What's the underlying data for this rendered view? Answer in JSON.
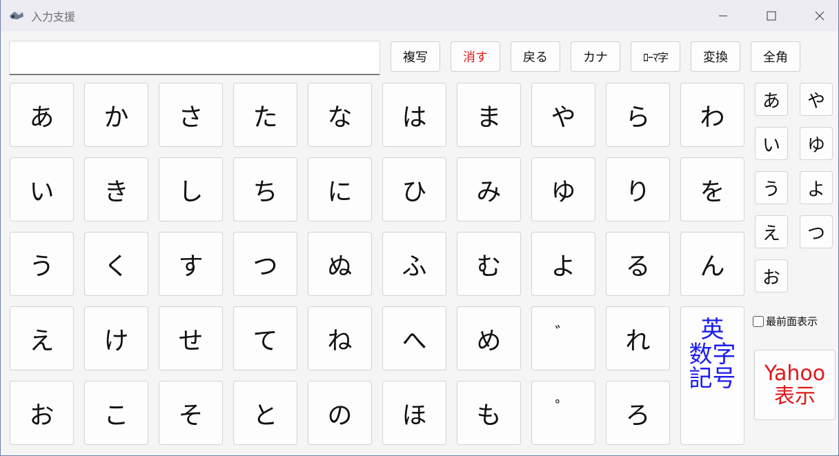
{
  "window": {
    "title": "入力支援"
  },
  "input": {
    "value": "",
    "placeholder": ""
  },
  "toolbar": [
    {
      "label": "複写",
      "color": "#111111"
    },
    {
      "label": "消す",
      "color": "#e01818"
    },
    {
      "label": "戻る",
      "color": "#111111"
    },
    {
      "label": "カナ",
      "color": "#111111"
    },
    {
      "label": "ﾛｰﾏ字",
      "color": "#111111"
    },
    {
      "label": "変換",
      "color": "#111111"
    },
    {
      "label": "全角",
      "color": "#111111"
    }
  ],
  "keyboard": {
    "columns": [
      [
        "あ",
        "い",
        "う",
        "え",
        "お"
      ],
      [
        "か",
        "き",
        "く",
        "け",
        "こ"
      ],
      [
        "さ",
        "し",
        "す",
        "せ",
        "そ"
      ],
      [
        "た",
        "ち",
        "つ",
        "て",
        "と"
      ],
      [
        "な",
        "に",
        "ぬ",
        "ね",
        "の"
      ],
      [
        "は",
        "ひ",
        "ふ",
        "へ",
        "ほ"
      ],
      [
        "ま",
        "み",
        "む",
        "め",
        "も"
      ],
      [
        "や",
        "ゆ",
        "よ",
        "゛",
        "゜"
      ],
      [
        "ら",
        "り",
        "る",
        "れ",
        "ろ"
      ],
      [
        "わ",
        "を",
        "ん"
      ]
    ],
    "eisu_label": [
      "英",
      "数字",
      "記号"
    ]
  },
  "small_keys": {
    "left": [
      "あ",
      "い",
      "う",
      "え",
      "お"
    ],
    "right": [
      "や",
      "ゆ",
      "よ",
      "つ"
    ]
  },
  "options": {
    "topmost_label": "最前面表示",
    "topmost_checked": false
  },
  "yahoo": {
    "line1": "Yahoo",
    "line2": "表示"
  },
  "colors": {
    "accent_red": "#e01818",
    "accent_blue": "#1c1cf0"
  }
}
